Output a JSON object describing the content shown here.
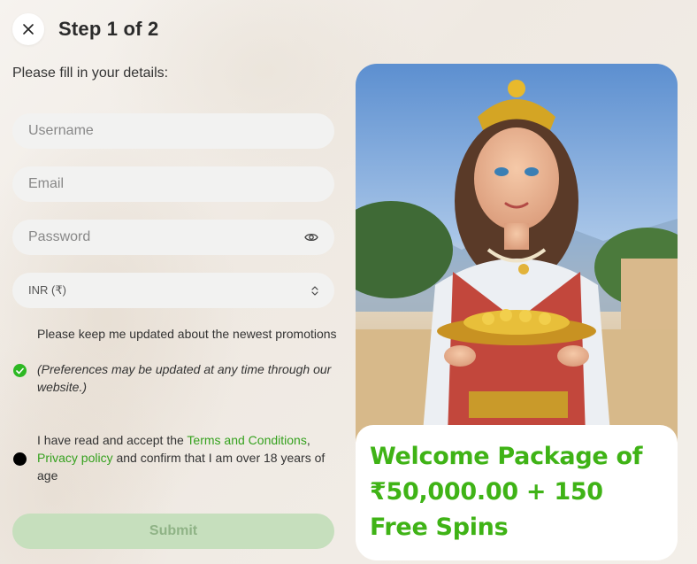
{
  "header": {
    "title": "Step 1 of 2"
  },
  "form": {
    "subtitle": "Please fill in your details:",
    "username_placeholder": "Username",
    "email_placeholder": "Email",
    "password_placeholder": "Password",
    "currency_value": "INR (₹)",
    "promo_consent_text": "Please keep me updated about the newest promotions",
    "promo_consent_note": "(Preferences may be updated at any time through our website.)",
    "terms_text_1": "I have read and accept the ",
    "terms_link": "Terms and Conditions",
    "terms_text_2": ",",
    "privacy_link": "Privacy policy",
    "terms_text_3": " and confirm that I am over 18 years of age",
    "submit_label": "Submit"
  },
  "promo": {
    "headline": "Welcome Package of ₹50,000.00 + 150 Free Spins"
  },
  "colors": {
    "accent_green": "#35a11e",
    "promo_green": "#3fb316",
    "submit_disabled_bg": "#c6dfbd"
  },
  "icons": {
    "close": "close-icon",
    "password_toggle": "eye-icon",
    "currency_select": "up-down-chevron-icon",
    "promo_checkbox": "check-circle-icon",
    "terms_checkbox": "filled-circle-icon"
  }
}
